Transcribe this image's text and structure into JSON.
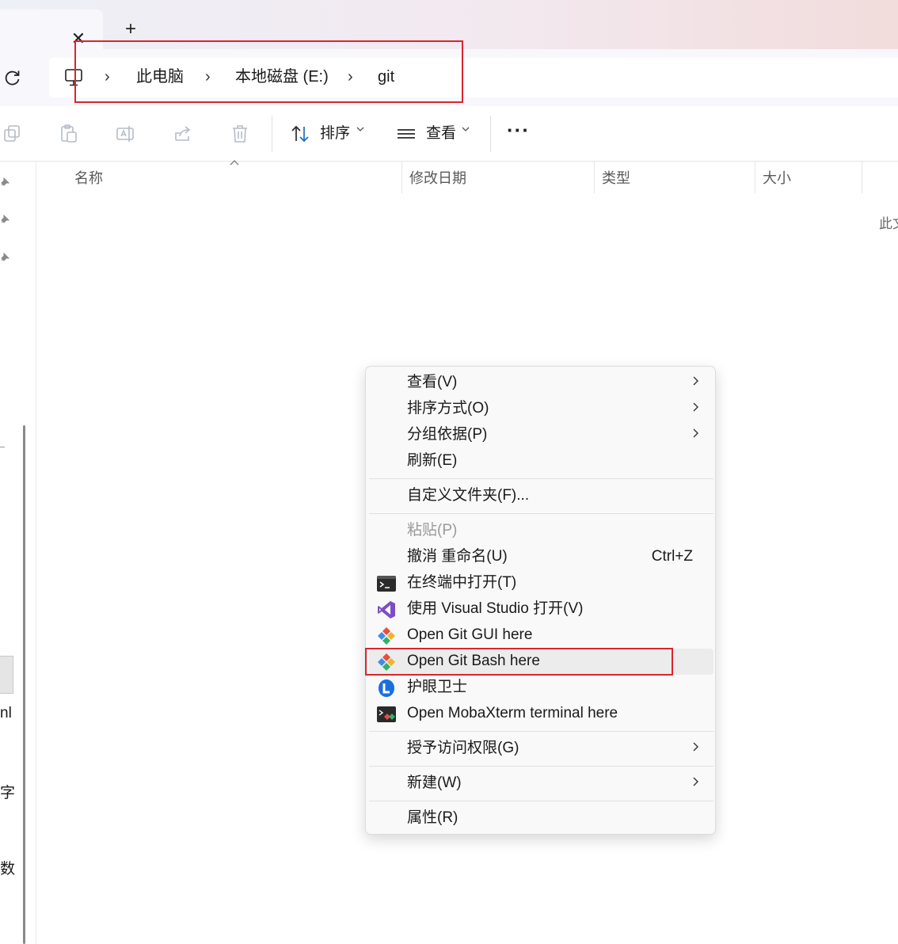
{
  "window": {
    "tab_close_glyph": "✕",
    "new_tab_glyph": "+"
  },
  "address_bar": {
    "breadcrumbs": [
      "此电脑",
      "本地磁盘 (E:)",
      "git"
    ],
    "separator": "›"
  },
  "toolbar": {
    "sort_label": "排序",
    "view_label": "查看",
    "more_label": "···"
  },
  "file_list": {
    "columns": [
      "名称",
      "修改日期",
      "类型",
      "大小"
    ],
    "empty_text_fragment": "此文"
  },
  "left_pane": {
    "fragments": [
      "nl",
      "字",
      "数"
    ]
  },
  "context_menu": {
    "items": [
      {
        "label": "查看(V)",
        "submenu": true
      },
      {
        "label": "排序方式(O)",
        "submenu": true
      },
      {
        "label": "分组依据(P)",
        "submenu": true
      },
      {
        "label": "刷新(E)"
      },
      {
        "label": "自定义文件夹(F)..."
      },
      {
        "label": "粘贴(P)",
        "disabled": true
      },
      {
        "label": "撤消 重命名(U)",
        "shortcut": "Ctrl+Z"
      },
      {
        "label": "在终端中打开(T)",
        "icon": "terminal-icon"
      },
      {
        "label": "使用 Visual Studio 打开(V)",
        "icon": "visual-studio-icon"
      },
      {
        "label": "Open Git GUI here",
        "icon": "git-icon"
      },
      {
        "label": "Open Git Bash here",
        "icon": "git-icon",
        "hovered": true
      },
      {
        "label": "护眼卫士",
        "icon": "eye-guard-icon"
      },
      {
        "label": "Open MobaXterm terminal here",
        "icon": "mobaxterm-icon"
      },
      {
        "label": "授予访问权限(G)",
        "submenu": true
      },
      {
        "label": "新建(W)",
        "submenu": true
      },
      {
        "label": "属性(R)"
      }
    ]
  },
  "colors": {
    "highlight_box": "#d8262e",
    "menu_hover": "#ececec"
  }
}
